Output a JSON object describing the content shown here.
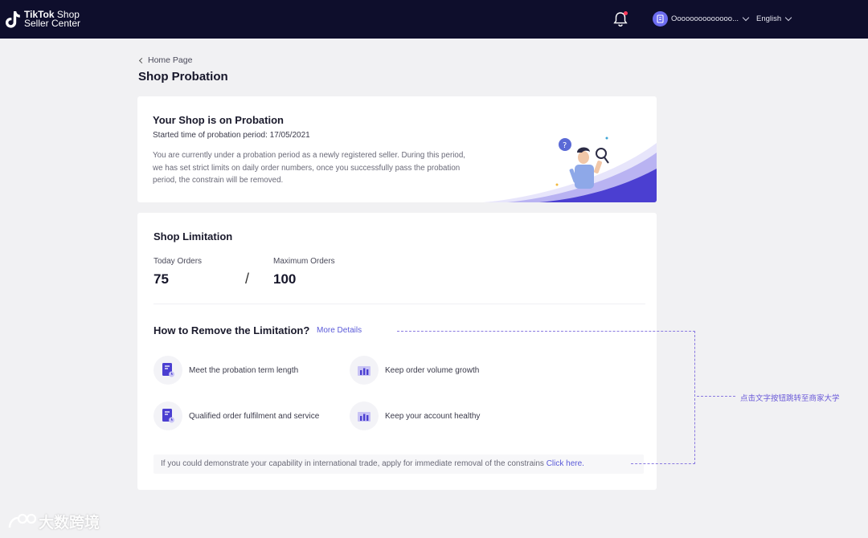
{
  "topbar": {
    "logo_line1": "TikTok",
    "logo_line1_b": " Shop",
    "logo_line2": "Seller Center",
    "account_name": "Oooooooooooooo...",
    "language": "English",
    "icons": {
      "bell": "bell-icon",
      "avatar": "store-icon"
    },
    "colors": {
      "bg": "#0e0e2c",
      "notification": "#ff3b5c"
    }
  },
  "breadcrumb": {
    "label": "Home Page"
  },
  "page_title": "Shop Probation",
  "probation": {
    "title": "Your Shop is on Probation",
    "started": "Started time of probation period: 17/05/2021",
    "description": "You are currently under a probation period as a newly registered seller. During this period, we has set strict limits on daily order numbers, once you successfully pass the probation period, the constrain will be removed."
  },
  "limitation": {
    "title": "Shop Limitation",
    "today_label": "Today Orders",
    "today_value": "75",
    "separator": "/",
    "max_label": "Maximum Orders",
    "max_value": "100"
  },
  "remove": {
    "title": "How to Remove the Limitation?",
    "more": "More Details",
    "items": [
      {
        "label": "Meet the probation term length",
        "icon": "document-clock-icon"
      },
      {
        "label": "Keep order volume growth",
        "icon": "bar-chart-icon"
      },
      {
        "label": "Qualified order fulfilment and service",
        "icon": "document-clock-icon"
      },
      {
        "label": "Keep your account healthy",
        "icon": "bar-chart-icon"
      }
    ],
    "footer_text": "If you could demonstrate your capability in international trade, apply for immediate removal of the constrains ",
    "footer_link": "Click here."
  },
  "annotation": {
    "text": "点击文字按钮跳转至商家大学"
  },
  "watermark": {
    "text": "大数跨境"
  },
  "colors": {
    "accent": "#5a5ad8",
    "illustration": "#4b3fd1"
  }
}
